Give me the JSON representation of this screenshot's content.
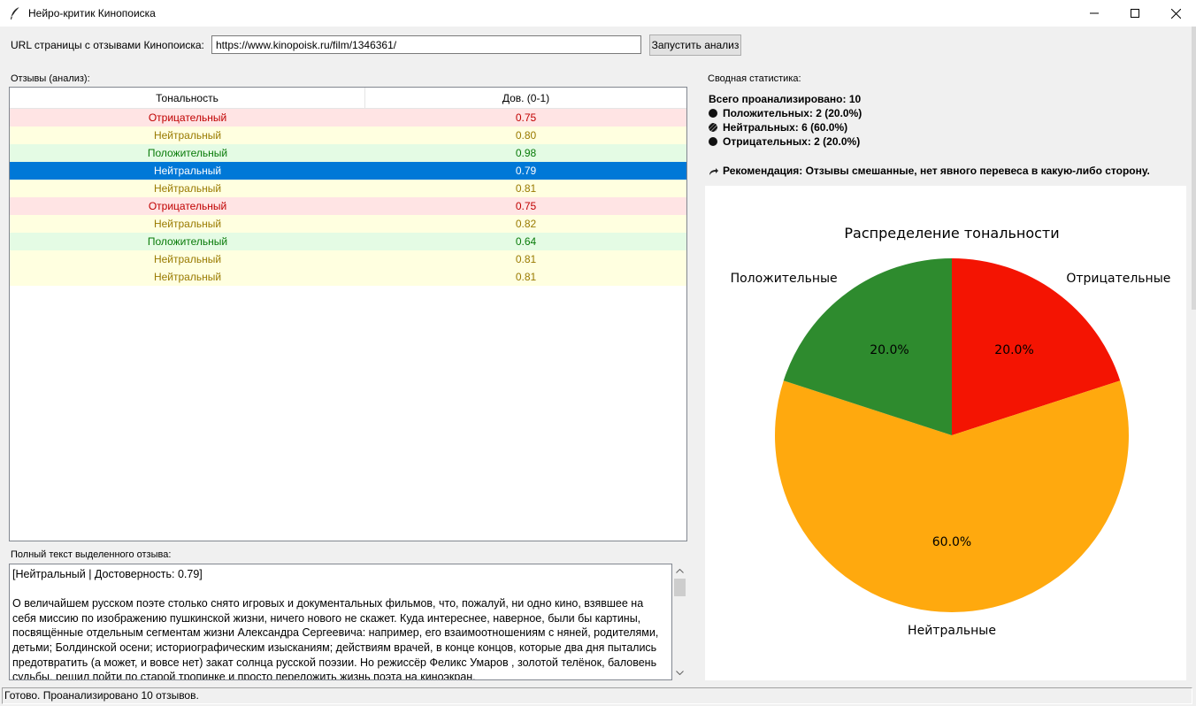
{
  "window": {
    "title": "Нейро-критик Кинопоиска"
  },
  "url_row": {
    "label": "URL страницы с отзывами Кинопоиска:",
    "value": "https://www.kinopoisk.ru/film/1346361/",
    "run_button": "Запустить анализ"
  },
  "reviews": {
    "label": "Отзывы (анализ):",
    "columns": [
      "Тональность",
      "Дов. (0-1)"
    ],
    "rows": [
      {
        "sentiment": "Отрицательный",
        "confidence": "0.75",
        "kind": "neg"
      },
      {
        "sentiment": "Нейтральный",
        "confidence": "0.80",
        "kind": "neu"
      },
      {
        "sentiment": "Положительный",
        "confidence": "0.98",
        "kind": "pos"
      },
      {
        "sentiment": "Нейтральный",
        "confidence": "0.79",
        "kind": "sel"
      },
      {
        "sentiment": "Нейтральный",
        "confidence": "0.81",
        "kind": "neu"
      },
      {
        "sentiment": "Отрицательный",
        "confidence": "0.75",
        "kind": "neg"
      },
      {
        "sentiment": "Нейтральный",
        "confidence": "0.82",
        "kind": "neu"
      },
      {
        "sentiment": "Положительный",
        "confidence": "0.64",
        "kind": "pos"
      },
      {
        "sentiment": "Нейтральный",
        "confidence": "0.81",
        "kind": "neu"
      },
      {
        "sentiment": "Нейтральный",
        "confidence": "0.81",
        "kind": "neu"
      }
    ]
  },
  "full_text": {
    "label": "Полный текст выделенного отзыва:",
    "text": "[Нейтральный | Достоверность: 0.79]\n\nО величайшем русском поэте столько снято игровых и документальных фильмов, что, пожалуй, ни одно кино, взявшее на себя миссию по изображению пушкинской жизни, ничего нового не скажет. Куда интереснее, наверное, были бы картины, посвящённые отдельным сегментам жизни Александра Сергеевича: например, его взаимоотношениям с няней, родителями, детьми; Болдинской осени; историографическим изысканиям; действиям врачей, в конце концов, которые два дня пытались предотвратить (а может, и вовсе нет) закат солнца русской поэзии. Но режиссёр Феликс Умаров , золотой телёнок, баловень судьбы, решил пойти по старой тропинке и просто переложить жизнь поэта на киноэкран,"
  },
  "status": {
    "text": "Готово. Проанализировано 10 отзывов."
  },
  "summary": {
    "label": "Сводная статистика:",
    "total": "Всего проанализировано: 10",
    "positive": "Положительных: 2 (20.0%)",
    "neutral": "Нейтральных: 6 (60.0%)",
    "negative": "Отрицательных: 2 (20.0%)",
    "recommendation": "Рекомендация: Отзывы смешанные, нет явного перевеса в какую-либо сторону."
  },
  "colors": {
    "positive": "#2e8b2e",
    "neutral": "#ffa90e",
    "negative": "#f41402",
    "selection": "#0078d7"
  },
  "chart_data": {
    "type": "pie",
    "title": "Распределение тональности",
    "slices": [
      {
        "label": "Отрицательные",
        "value": 20.0,
        "pct_label": "20.0%",
        "color": "#f41402"
      },
      {
        "label": "Нейтральные",
        "value": 60.0,
        "pct_label": "60.0%",
        "color": "#ffa90e"
      },
      {
        "label": "Положительные",
        "value": 20.0,
        "pct_label": "20.0%",
        "color": "#2e8b2e"
      }
    ],
    "start_angle": "top, clockwise"
  }
}
